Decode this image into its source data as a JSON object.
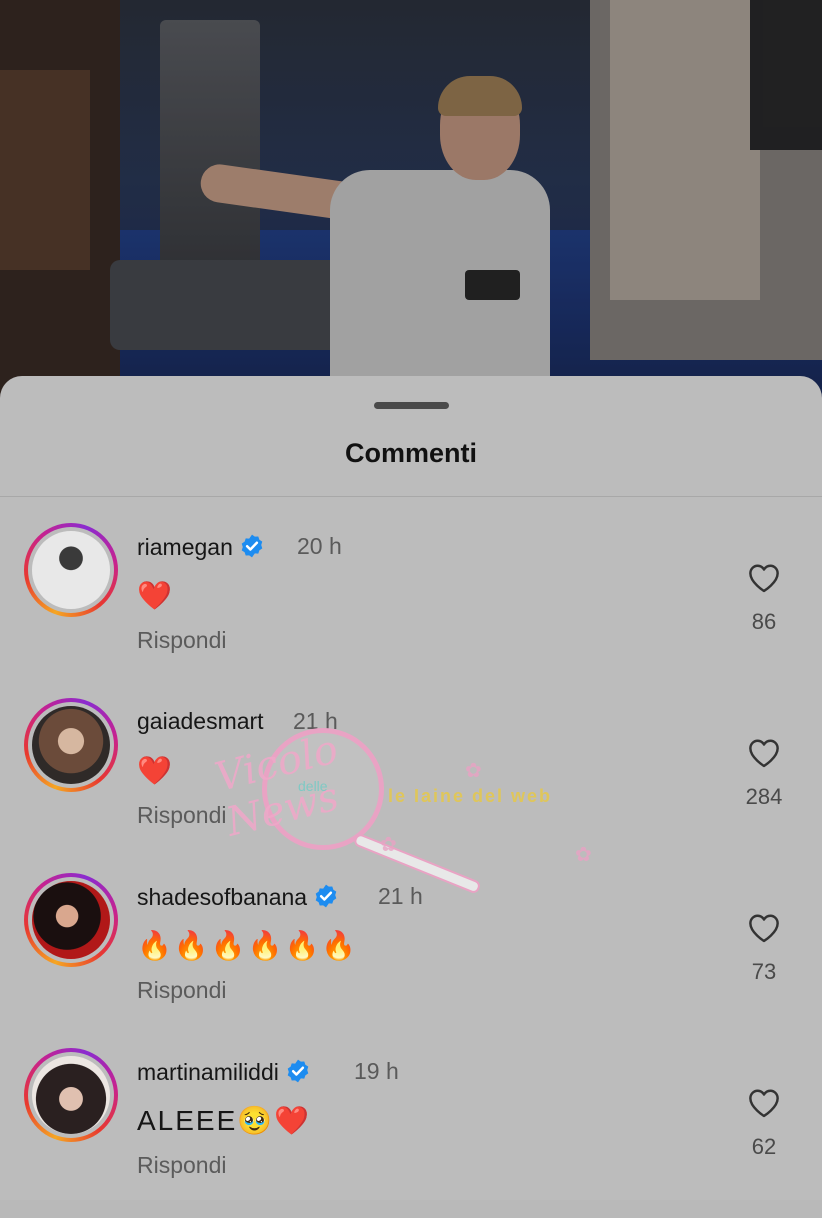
{
  "sheet": {
    "title": "Commenti"
  },
  "comments": [
    {
      "username": "riamegan",
      "verified": true,
      "time": "20 h",
      "text": "❤️",
      "reply": "Rispondi",
      "likes": "86"
    },
    {
      "username": "gaiadesmart",
      "verified": false,
      "time": "21 h",
      "text": "❤️",
      "reply": "Rispondi",
      "likes": "284"
    },
    {
      "username": "shadesofbanana",
      "verified": true,
      "time": "21 h",
      "text": "🔥🔥🔥🔥🔥🔥",
      "reply": "Rispondi",
      "likes": "73"
    },
    {
      "username": "martinamiliddi",
      "verified": true,
      "time": "19 h",
      "text": "ALEEE🥹❤️",
      "reply": "Rispondi",
      "likes": "62"
    }
  ],
  "watermark": {
    "script": "Vicolo",
    "delle": "delle",
    "news": "News",
    "caption": "le Iaine del web"
  },
  "icons": {
    "verified": "verified-badge-icon",
    "heart": "heart-outline-icon"
  },
  "colors": {
    "verified": "#1d8cf0",
    "story_ring": [
      "#f5a623",
      "#e8382f",
      "#c7228f",
      "#8a2bd0"
    ]
  }
}
